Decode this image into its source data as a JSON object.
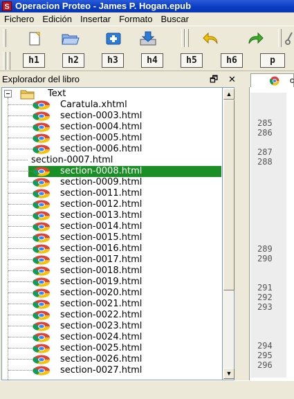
{
  "window": {
    "title": "Operacion Proteo - James P. Hogan.epub",
    "app_icon": "S"
  },
  "menu": [
    "Fichero",
    "Edición",
    "Insertar",
    "Formato",
    "Buscar"
  ],
  "toolbar_headings": [
    "h1",
    "h2",
    "h3",
    "h4",
    "h5",
    "h6",
    "p"
  ],
  "panel": {
    "title": "Explorador del libro",
    "float_symbol": "🗗",
    "close_symbol": "✕"
  },
  "tree": {
    "folder": "Text",
    "files": [
      "Caratula.xhtml",
      "section-0003.html",
      "section-0004.html",
      "section-0005.html",
      "section-0006.html",
      "section-0007.html",
      "section-0008.html",
      "section-0009.html",
      "section-0011.html",
      "section-0012.html",
      "section-0013.html",
      "section-0014.html",
      "section-0015.html",
      "section-0016.html",
      "section-0017.html",
      "section-0018.html",
      "section-0019.html",
      "section-0020.html",
      "section-0021.html",
      "section-0022.html",
      "section-0023.html",
      "section-0024.html",
      "section-0025.html",
      "section-0026.html",
      "section-0027.html"
    ],
    "selected_index": 6,
    "no_icon_index": 5
  },
  "editor": {
    "tab_label": "c",
    "line_numbers": [
      "285",
      "286",
      "287",
      "288",
      "289",
      "290",
      "291",
      "292",
      "293",
      "294",
      "295",
      "296"
    ]
  },
  "colors": {
    "selection": "#1a8f25",
    "titlebar": "#0a3cc4"
  }
}
